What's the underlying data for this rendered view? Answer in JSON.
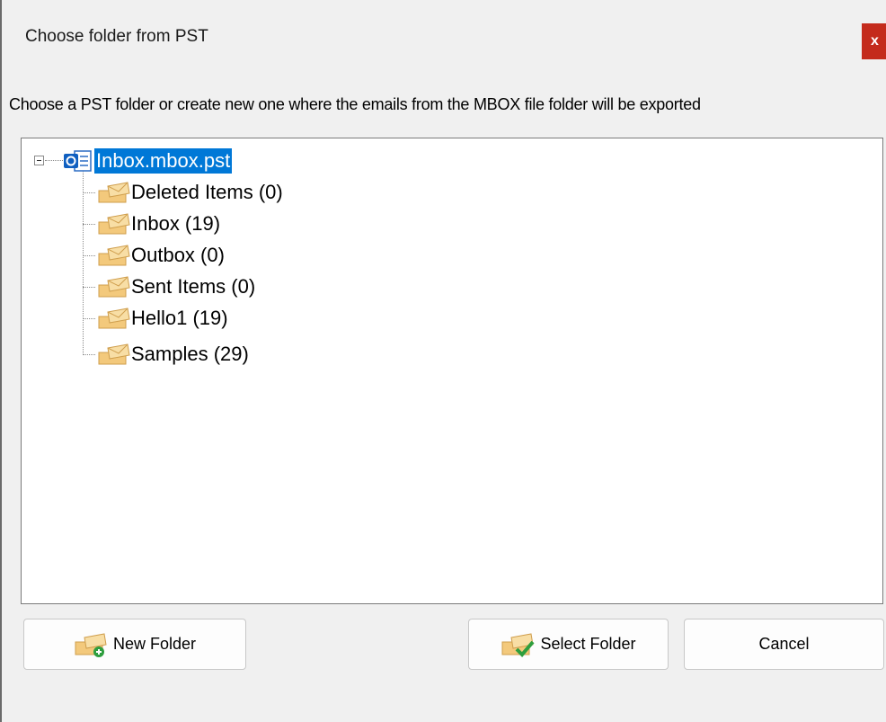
{
  "dialog": {
    "title": "Choose folder from PST",
    "close_label": "x",
    "instruction": "Choose a PST folder or create new one where the emails from the MBOX file folder will be exported"
  },
  "tree": {
    "root": {
      "label": "Inbox.mbox.pst",
      "icon": "pst-file-icon",
      "expanded": true,
      "selected": true
    },
    "folders": [
      {
        "label": "Deleted Items (0)",
        "icon": "envelope-folder-icon"
      },
      {
        "label": "Inbox (19)",
        "icon": "envelope-folder-icon"
      },
      {
        "label": "Outbox (0)",
        "icon": "envelope-folder-icon"
      },
      {
        "label": "Sent Items (0)",
        "icon": "envelope-folder-icon"
      },
      {
        "label": "Hello1 (19)",
        "icon": "envelope-folder-icon"
      },
      {
        "label": "Samples (29)",
        "icon": "envelope-folder-icon"
      }
    ]
  },
  "buttons": {
    "new_folder": "New Folder",
    "select_folder": "Select Folder",
    "cancel": "Cancel"
  },
  "colors": {
    "selection": "#0078d7",
    "close": "#c42b1c",
    "envelope": "#e8b86b"
  }
}
